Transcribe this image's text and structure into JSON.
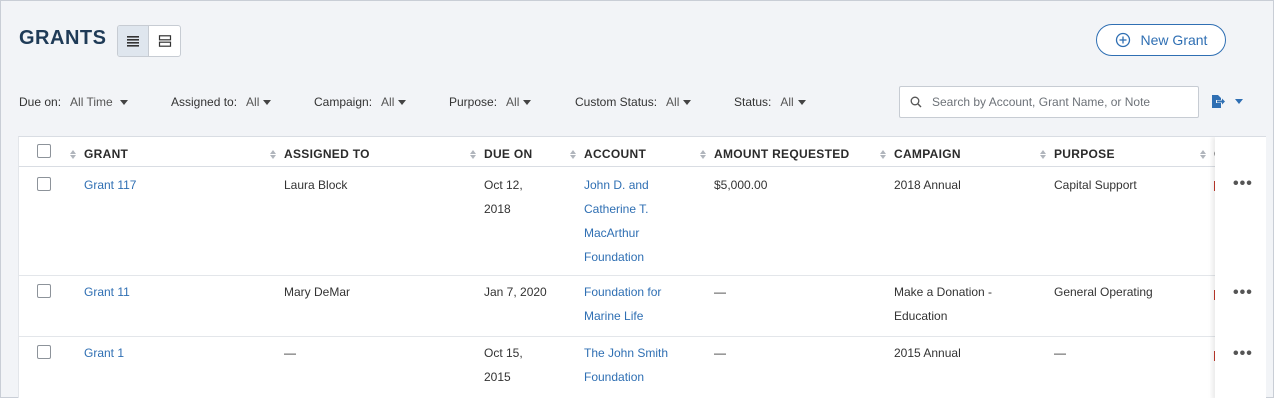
{
  "page": {
    "title": "GRANTS",
    "new_button": "New Grant"
  },
  "view_toggle": {
    "list_icon": "list-view-icon",
    "card_icon": "card-view-icon"
  },
  "filters": [
    {
      "label": "Due on:",
      "value": "All Time"
    },
    {
      "label": "Assigned to:",
      "value": "All"
    },
    {
      "label": "Campaign:",
      "value": "All"
    },
    {
      "label": "Purpose:",
      "value": "All"
    },
    {
      "label": "Custom Status:",
      "value": "All"
    },
    {
      "label": "Status:",
      "value": "All"
    }
  ],
  "search": {
    "placeholder": "Search by Account, Grant Name, or Note"
  },
  "table": {
    "columns": [
      "GRANT",
      "ASSIGNED TO",
      "DUE ON",
      "ACCOUNT",
      "AMOUNT REQUESTED",
      "CAMPAIGN",
      "PURPOSE",
      "C"
    ],
    "rows": [
      {
        "grant": "Grant 117",
        "assigned_to": "Laura Block",
        "due_on": [
          "Oct 12,",
          "2018"
        ],
        "account": [
          "John D. and",
          "Catherine T.",
          "MacArthur",
          "Foundation"
        ],
        "amount": "$5,000.00",
        "campaign": [
          "2018 Annual"
        ],
        "purpose": "Capital Support"
      },
      {
        "grant": "Grant 11",
        "assigned_to": "Mary DeMar",
        "due_on": [
          "Jan 7, 2020"
        ],
        "account": [
          "Foundation for",
          "Marine Life"
        ],
        "amount": "—",
        "campaign": [
          "Make a Donation -",
          "Education"
        ],
        "purpose": "General Operating"
      },
      {
        "grant": "Grant 1",
        "assigned_to": "—",
        "due_on": [
          "Oct 15,",
          "2015"
        ],
        "account": [
          "The John Smith",
          "Foundation"
        ],
        "amount": "—",
        "campaign": [
          "2015 Annual"
        ],
        "purpose": "—"
      }
    ]
  },
  "colors": {
    "accent": "#2f6fb3",
    "title": "#1f3b57",
    "background": "#f2f4f7"
  }
}
